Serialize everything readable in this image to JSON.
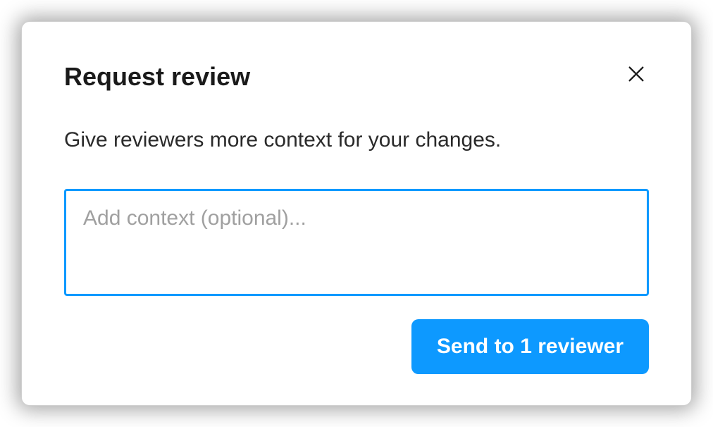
{
  "modal": {
    "title": "Request review",
    "subtitle": "Give reviewers more context for your changes.",
    "context_placeholder": "Add context (optional)...",
    "context_value": "",
    "send_button_label": "Send to 1 reviewer"
  }
}
